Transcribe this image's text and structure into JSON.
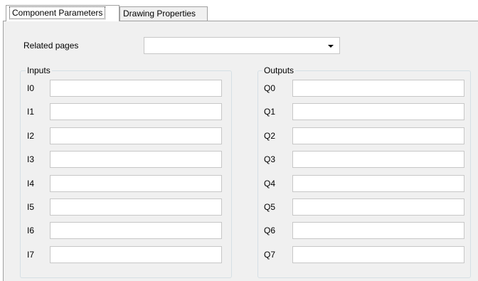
{
  "tabs": [
    {
      "label": "Component Parameters",
      "active": true
    },
    {
      "label": "Drawing Properties",
      "active": false
    }
  ],
  "related_pages": {
    "label": "Related pages",
    "value": ""
  },
  "inputs": {
    "title": "Inputs",
    "rows": [
      {
        "label": "I0",
        "value": ""
      },
      {
        "label": "I1",
        "value": ""
      },
      {
        "label": "I2",
        "value": ""
      },
      {
        "label": "I3",
        "value": ""
      },
      {
        "label": "I4",
        "value": ""
      },
      {
        "label": "I5",
        "value": ""
      },
      {
        "label": "I6",
        "value": ""
      },
      {
        "label": "I7",
        "value": ""
      }
    ]
  },
  "outputs": {
    "title": "Outputs",
    "rows": [
      {
        "label": "Q0",
        "value": ""
      },
      {
        "label": "Q1",
        "value": ""
      },
      {
        "label": "Q2",
        "value": ""
      },
      {
        "label": "Q3",
        "value": ""
      },
      {
        "label": "Q4",
        "value": ""
      },
      {
        "label": "Q5",
        "value": ""
      },
      {
        "label": "Q6",
        "value": ""
      },
      {
        "label": "Q7",
        "value": ""
      }
    ]
  }
}
